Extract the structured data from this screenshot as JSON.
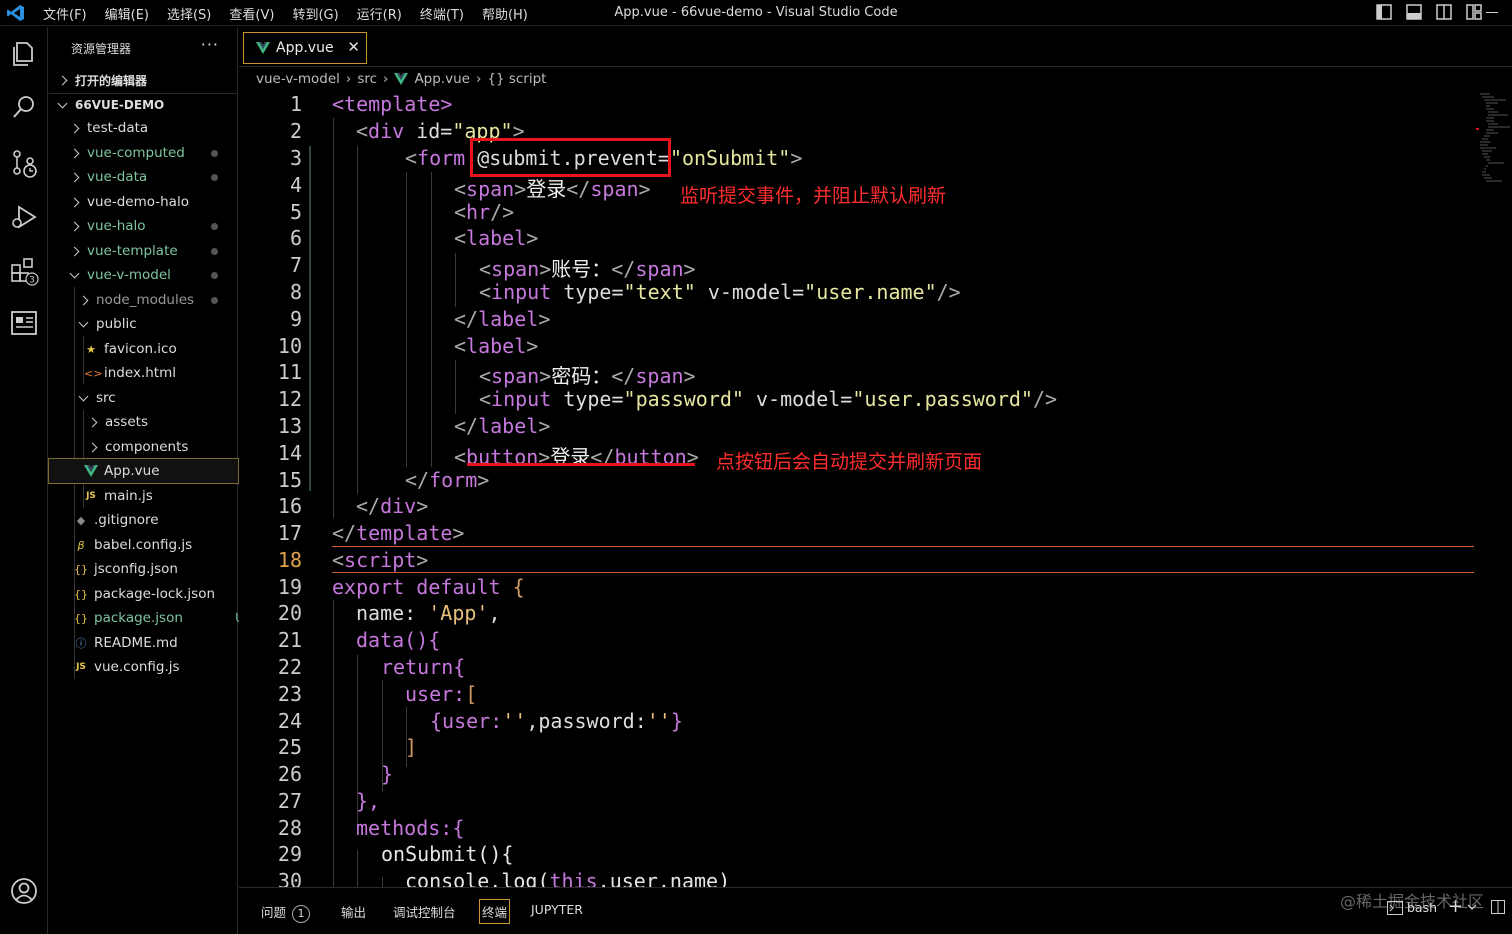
{
  "titlebar": {
    "menu": [
      "文件(F)",
      "编辑(E)",
      "选择(S)",
      "查看(V)",
      "转到(G)",
      "运行(R)",
      "终端(T)",
      "帮助(H)"
    ],
    "title": "App.vue - 66vue-demo - Visual Studio Code"
  },
  "sidebar": {
    "header": "资源管理器",
    "more": "···",
    "open_editors": "打开的编辑器",
    "root": "66VUE-DEMO",
    "items": [
      {
        "label": "test-data"
      },
      {
        "label": "vue-computed"
      },
      {
        "label": "vue-data"
      },
      {
        "label": "vue-demo-halo"
      },
      {
        "label": "vue-halo"
      },
      {
        "label": "vue-template"
      },
      {
        "label": "vue-v-model"
      },
      {
        "label": "node_modules"
      },
      {
        "label": "public"
      },
      {
        "label": "favicon.ico"
      },
      {
        "label": "index.html"
      },
      {
        "label": "src"
      },
      {
        "label": "assets"
      },
      {
        "label": "components"
      },
      {
        "label": "App.vue"
      },
      {
        "label": "main.js"
      },
      {
        "label": ".gitignore"
      },
      {
        "label": "babel.config.js"
      },
      {
        "label": "jsconfig.json"
      },
      {
        "label": "package-lock.json"
      },
      {
        "label": "package.json",
        "badge": "U"
      },
      {
        "label": "README.md"
      },
      {
        "label": "vue.config.js"
      }
    ],
    "icons": {
      "js": "JS",
      "json": "{}",
      "html": "<>"
    }
  },
  "tabs": [
    {
      "label": "App.vue",
      "close": "✕"
    }
  ],
  "breadcrumb": [
    "vue-v-model",
    "src",
    "App.vue",
    "{} script"
  ],
  "line_numbers": [
    "1",
    "2",
    "3",
    "4",
    "5",
    "6",
    "7",
    "8",
    "9",
    "10",
    "11",
    "12",
    "13",
    "14",
    "15",
    "16",
    "17",
    "18",
    "19",
    "20",
    "21",
    "22",
    "23",
    "24",
    "25",
    "26",
    "27",
    "28",
    "29",
    "30"
  ],
  "code": {
    "l1_open": "<template>",
    "l2_tag": "div",
    "l2_attr": "id=",
    "l2_val": "\"app\"",
    "l3_tag": "form",
    "l3_dir": "@submit.prevent",
    "l3_eq": "=",
    "l3_val": "\"onSubmit\"",
    "l4_text": "登录",
    "l4_tag": "span",
    "l5_tag": "hr",
    "l6_tag": "label",
    "l7_tag": "span",
    "l7_text": "账号：",
    "l8_tag": "input",
    "l8_type": "type=",
    "l8_typeval": "\"text\"",
    "l8_vm": "v-model=",
    "l8_vmval": "\"user.name\"",
    "l9_tag": "label",
    "l10_tag": "label",
    "l11_tag": "span",
    "l11_text": "密码：",
    "l12_tag": "input",
    "l12_type": "type=",
    "l12_typeval": "\"password\"",
    "l12_vm": "v-model=",
    "l12_vmval": "\"user.password\"",
    "l13_tag": "label",
    "l14_tag": "button",
    "l14_text": "登录",
    "l15_tag": "form",
    "l16_tag": "div",
    "l17_tag": "template",
    "l18_tag": "script",
    "l19": "export default",
    "l19_brace": "{",
    "l20_key": "name:",
    "l20_val": "'App'",
    "l20_comma": ",",
    "l21": "data(){",
    "l22": "return{",
    "l23_key": "user:",
    "l23_br": "[",
    "l24_a": "{user:",
    "l24_v1": "''",
    "l24_b": ",password:",
    "l24_v2": "''",
    "l24_c": "}",
    "l25": "]",
    "l26": "}",
    "l27": "},",
    "l28": "methods:{",
    "l29": "onSubmit(){",
    "l30_fn": "console.log(",
    "l30_this": "this",
    "l30_rest": ".user.name)"
  },
  "annotations": {
    "a1": "监听提交事件，并阻止默认刷新",
    "a2": "点按钮后会自动提交并刷新页面"
  },
  "panel": {
    "tabs": [
      "问题",
      "输出",
      "调试控制台",
      "终端",
      "JUPYTER"
    ],
    "problems_count": "1",
    "shell": "bash",
    "add": "+",
    "watermark": "@稀土掘金技术社区"
  },
  "colors": {
    "accent": "#c8932f",
    "annotation": "#e8141c",
    "tag": "#c678dd",
    "string": "#e6e6a0"
  }
}
